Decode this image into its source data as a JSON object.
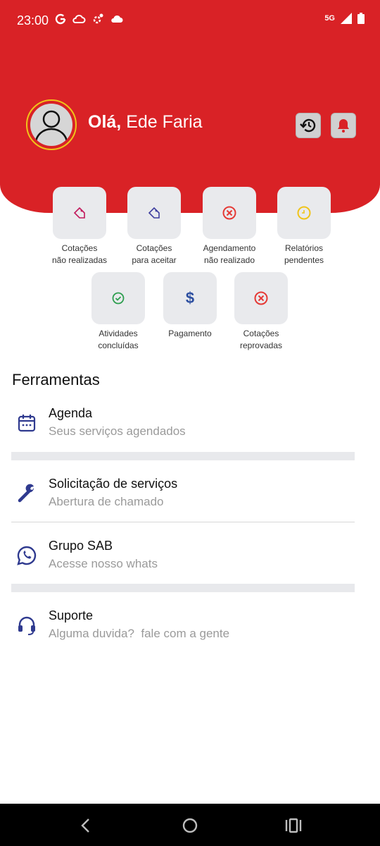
{
  "status_bar": {
    "time": "23:00",
    "network": "5G"
  },
  "header": {
    "greeting_hello": "Olá,",
    "user_name": "Ede Faria",
    "brand_color": "#d92226"
  },
  "quick_actions": [
    {
      "label": "Cotações\nnão realizadas",
      "icon": "tag-icon",
      "color": "#c2185b"
    },
    {
      "label": "Cotações\npara aceitar",
      "icon": "tag-icon",
      "color": "#3f3f9f"
    },
    {
      "label": "Agendamento\nnão realizado",
      "icon": "x-circle-icon",
      "color": "#e53935"
    },
    {
      "label": "Relatórios\npendentes",
      "icon": "clock-icon",
      "color": "#f0c419"
    },
    {
      "label": "Atividades\nconcluídas",
      "icon": "check-circle-icon",
      "color": "#2e9e4f"
    },
    {
      "label": "Pagamento",
      "icon": "dollar-icon",
      "color": "#2d4fa0"
    },
    {
      "label": "Cotações\nreprovadas",
      "icon": "x-circle-icon",
      "color": "#e53935"
    }
  ],
  "tools": {
    "title": "Ferramentas",
    "items": [
      {
        "title": "Agenda",
        "subtitle": "Seus serviços agendados",
        "icon": "calendar-icon"
      },
      {
        "title": "Solicitação de serviços",
        "subtitle": "Abertura de chamado",
        "icon": "wrench-icon"
      },
      {
        "title": "Grupo SAB",
        "subtitle": "Acesse nosso whats",
        "icon": "whatsapp-icon"
      },
      {
        "title": "Suporte",
        "subtitle": "Alguma duvida?  fale com a gente",
        "icon": "headset-icon"
      }
    ],
    "icon_color": "#2f3a8f"
  }
}
